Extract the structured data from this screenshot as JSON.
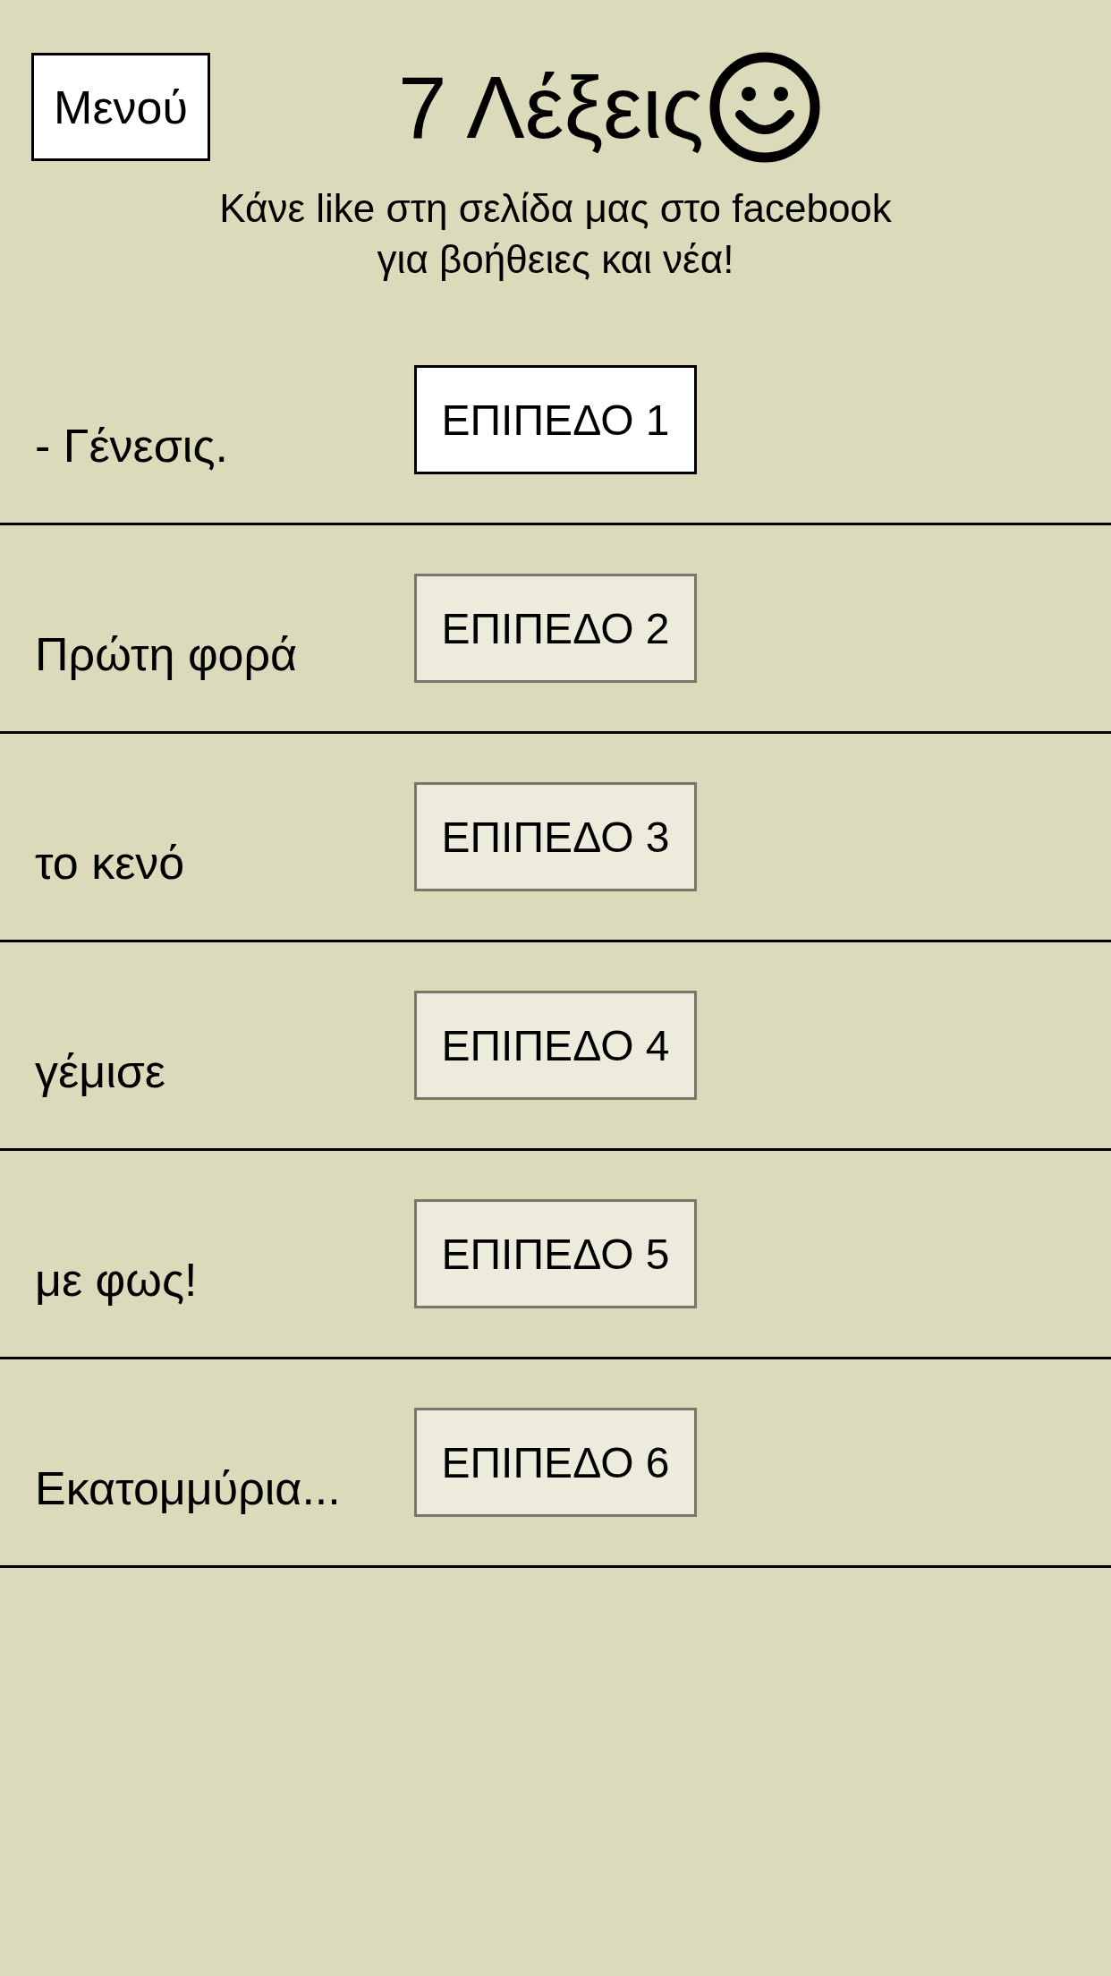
{
  "header": {
    "menu_button": "Μενού",
    "title": "7 Λέξεις",
    "subtitle": "Κάνε like στη σελίδα μας στο facebook για βοήθειες και νέα!"
  },
  "levels": [
    {
      "label": "- Γένεσις.",
      "button": "ΕΠΙΠΕΔΟ 1",
      "selected": true
    },
    {
      "label": "Πρώτη φορά",
      "button": "ΕΠΙΠΕΔΟ 2",
      "selected": false
    },
    {
      "label": "το κενό",
      "button": "ΕΠΙΠΕΔΟ 3",
      "selected": false
    },
    {
      "label": "γέμισε",
      "button": "ΕΠΙΠΕΔΟ 4",
      "selected": false
    },
    {
      "label": "με φως!",
      "button": "ΕΠΙΠΕΔΟ 5",
      "selected": false
    },
    {
      "label": "Εκατομμύρια...",
      "button": "ΕΠΙΠΕΔΟ 6",
      "selected": false
    }
  ]
}
